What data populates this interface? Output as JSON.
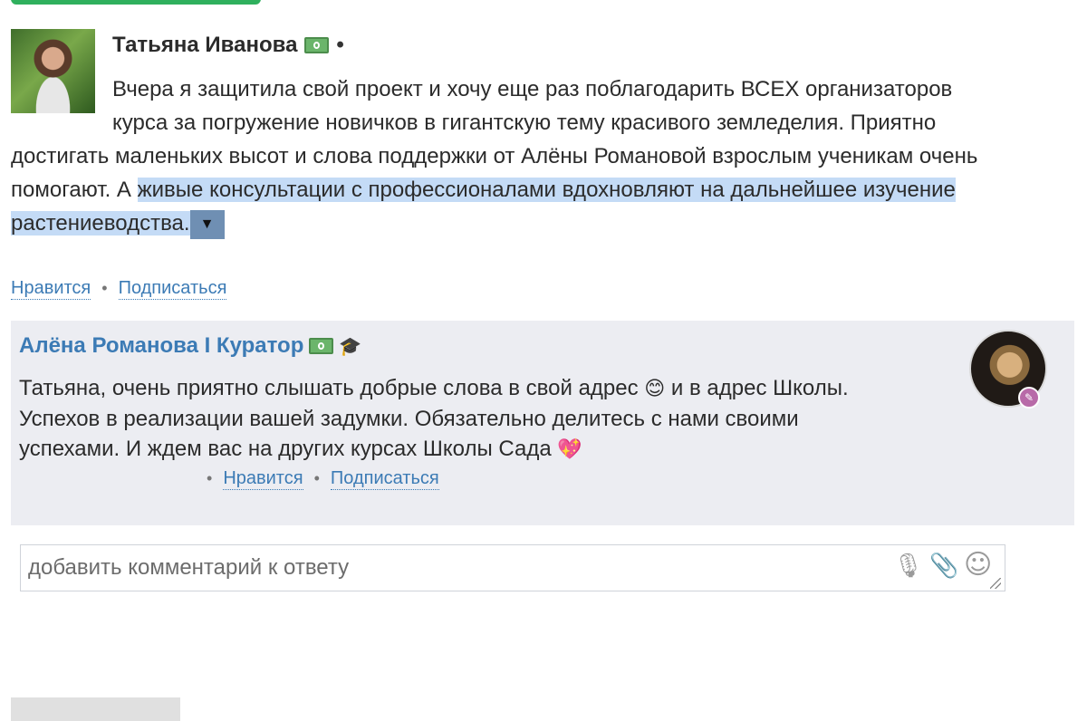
{
  "comment": {
    "author": "Татьяна Иванова",
    "bullet": "•",
    "text_line1": "Вчера я защитила свой проект и хочу еще раз поблагодарить ВСЕХ организаторов",
    "text_line2": "курса за погружение новичков в гигантскую тему красивого земледелия. Приятно",
    "text_line3": "достигать маленьких высот и слова поддержки от Алёны Романовой взрослым ученикам очень",
    "text_line4a": "помогают. А ",
    "text_highlighted_a": "живые консультации с профессионалами вдохновляют на дальнейшее изучение",
    "text_highlighted_b": "растениеводства.",
    "expand_icon": "▼",
    "actions": {
      "like": "Нравится",
      "separator": "•",
      "subscribe": "Подписаться"
    }
  },
  "reply": {
    "author": "Алёна Романова I Куратор",
    "grad_icon": "🎓",
    "text_part1": "Татьяна, очень приятно слышать добрые слова в свой адрес ",
    "emoji_smile": "😊",
    "text_part2": " и в адрес Школы.",
    "text_line2": "Успехов в реализации вашей задумки. Обязательно делитесь с нами своими",
    "text_line3": "успехами. И ждем вас на других курсах Школы Сада ",
    "emoji_heart": "💖",
    "actions": {
      "bullet": "•",
      "like": "Нравится",
      "separator": "•",
      "subscribe": "Подписаться"
    }
  },
  "input": {
    "placeholder": "добавить комментарий к ответу",
    "mic_icon": "🎙",
    "clip_icon": "📎",
    "emoji_icon": "☺"
  },
  "colors": {
    "link": "#3c7bb5",
    "highlight": "#c4dbf6",
    "reply_bg": "#ecedf2",
    "green_button": "#2fb05d"
  }
}
